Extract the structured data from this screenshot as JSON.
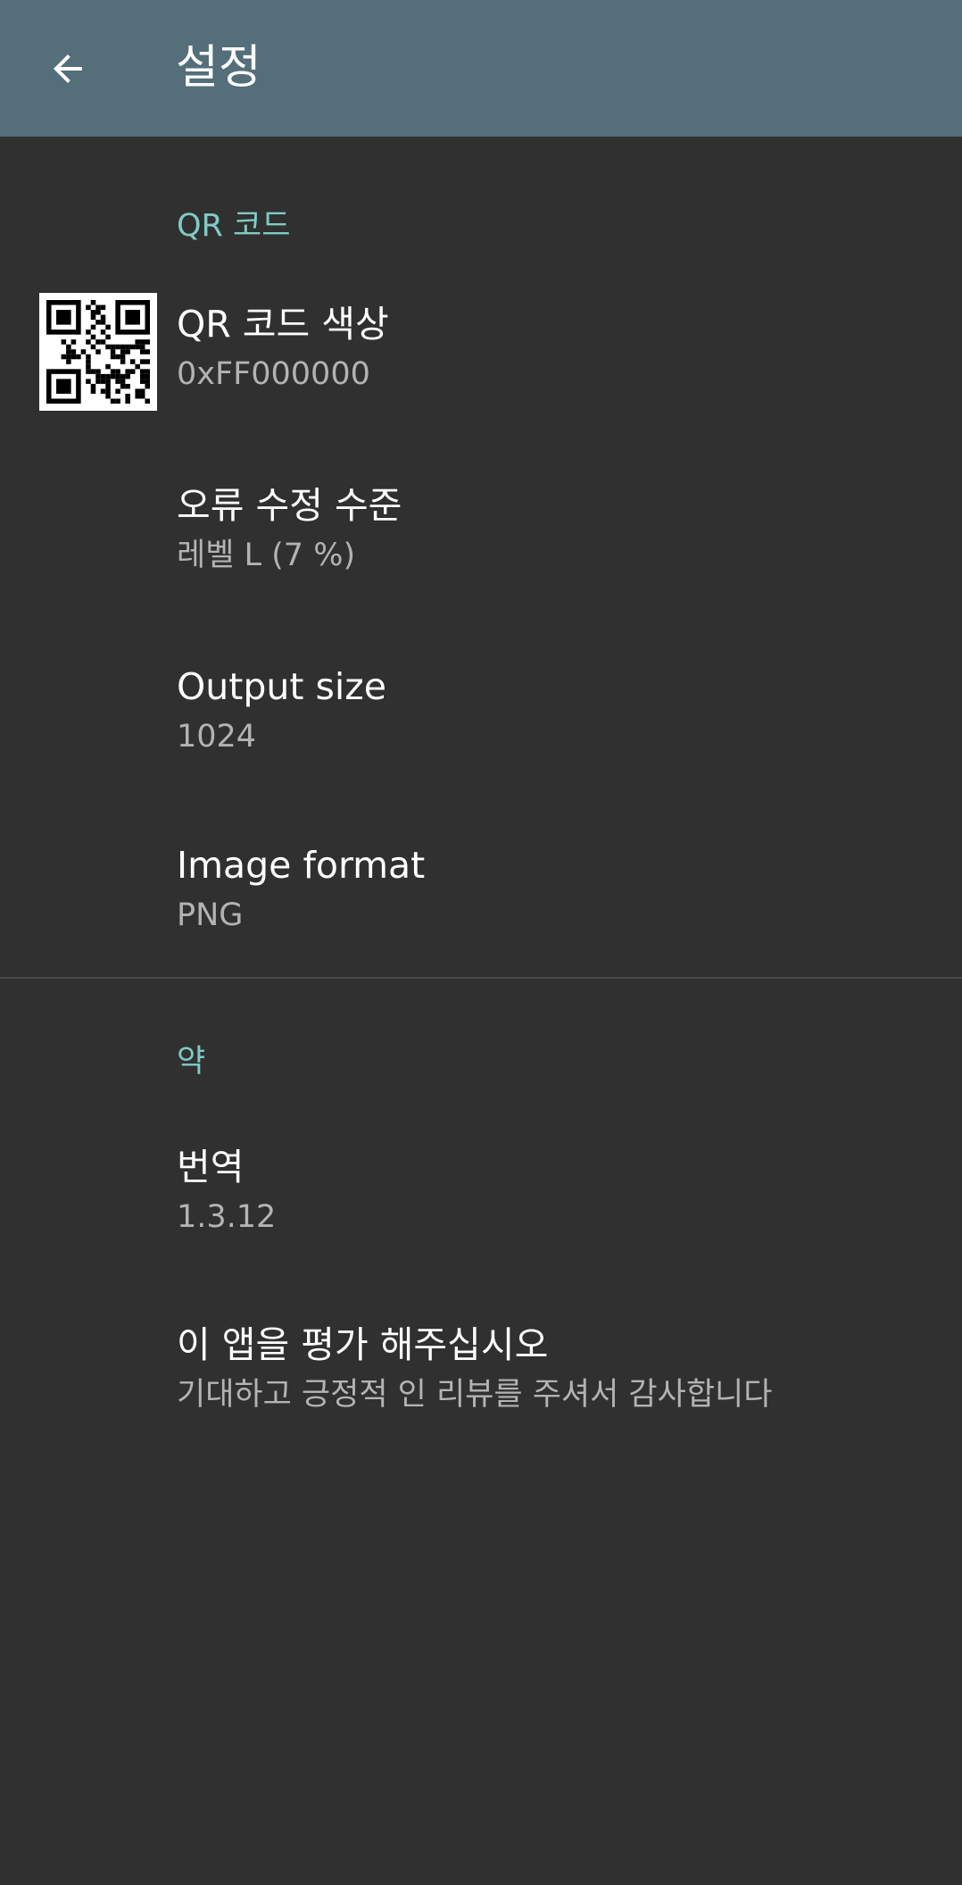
{
  "appbar": {
    "title": "설정",
    "back_icon": "arrow-back-icon"
  },
  "qr_section": {
    "header": "QR 코드",
    "items": [
      {
        "title": "QR 코드 색상",
        "summary": "0xFF000000",
        "icon": "qr-code-icon"
      },
      {
        "title": "오류 수정 수준",
        "summary": "레벨 L (7 %)"
      },
      {
        "title": "Output size",
        "summary": "1024"
      },
      {
        "title": "Image format",
        "summary": "PNG"
      }
    ]
  },
  "about_section": {
    "header": "약",
    "items": [
      {
        "title": "번역",
        "summary": "1.3.12"
      },
      {
        "title": "이 앱을 평가 해주십시오",
        "summary": "기대하고 긍정적 인 리뷰를 주셔서 감사합니다"
      }
    ]
  },
  "colors": {
    "appbar": "#546e7a",
    "background": "#303030",
    "accent": "#80cbc4"
  }
}
